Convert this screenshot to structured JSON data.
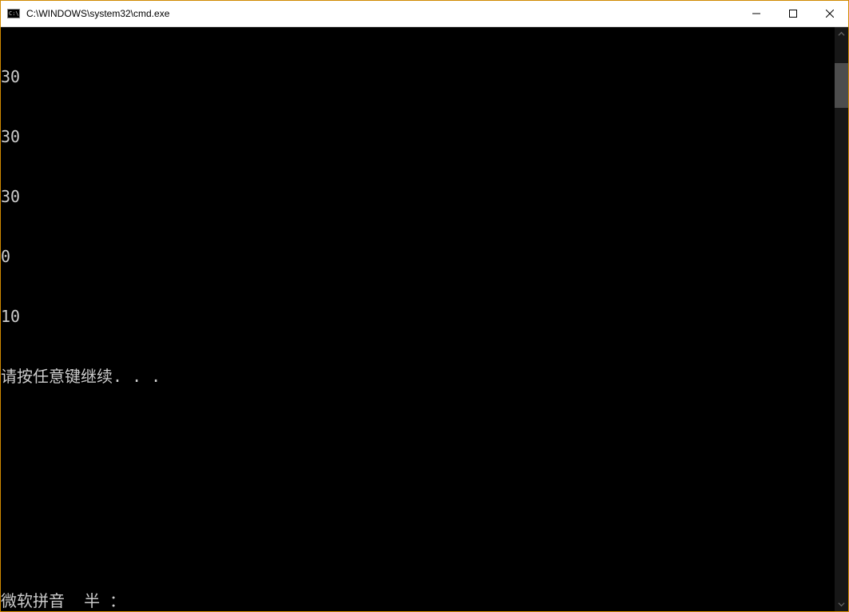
{
  "titlebar": {
    "title": "C:\\WINDOWS\\system32\\cmd.exe"
  },
  "console": {
    "lines": [
      "30",
      "30",
      "30",
      "0",
      "10",
      "请按任意键继续. . ."
    ],
    "ime_status": "微软拼音  半 ："
  },
  "scrollbar": {
    "thumb_top_pct": 4,
    "thumb_height_pct": 8
  }
}
